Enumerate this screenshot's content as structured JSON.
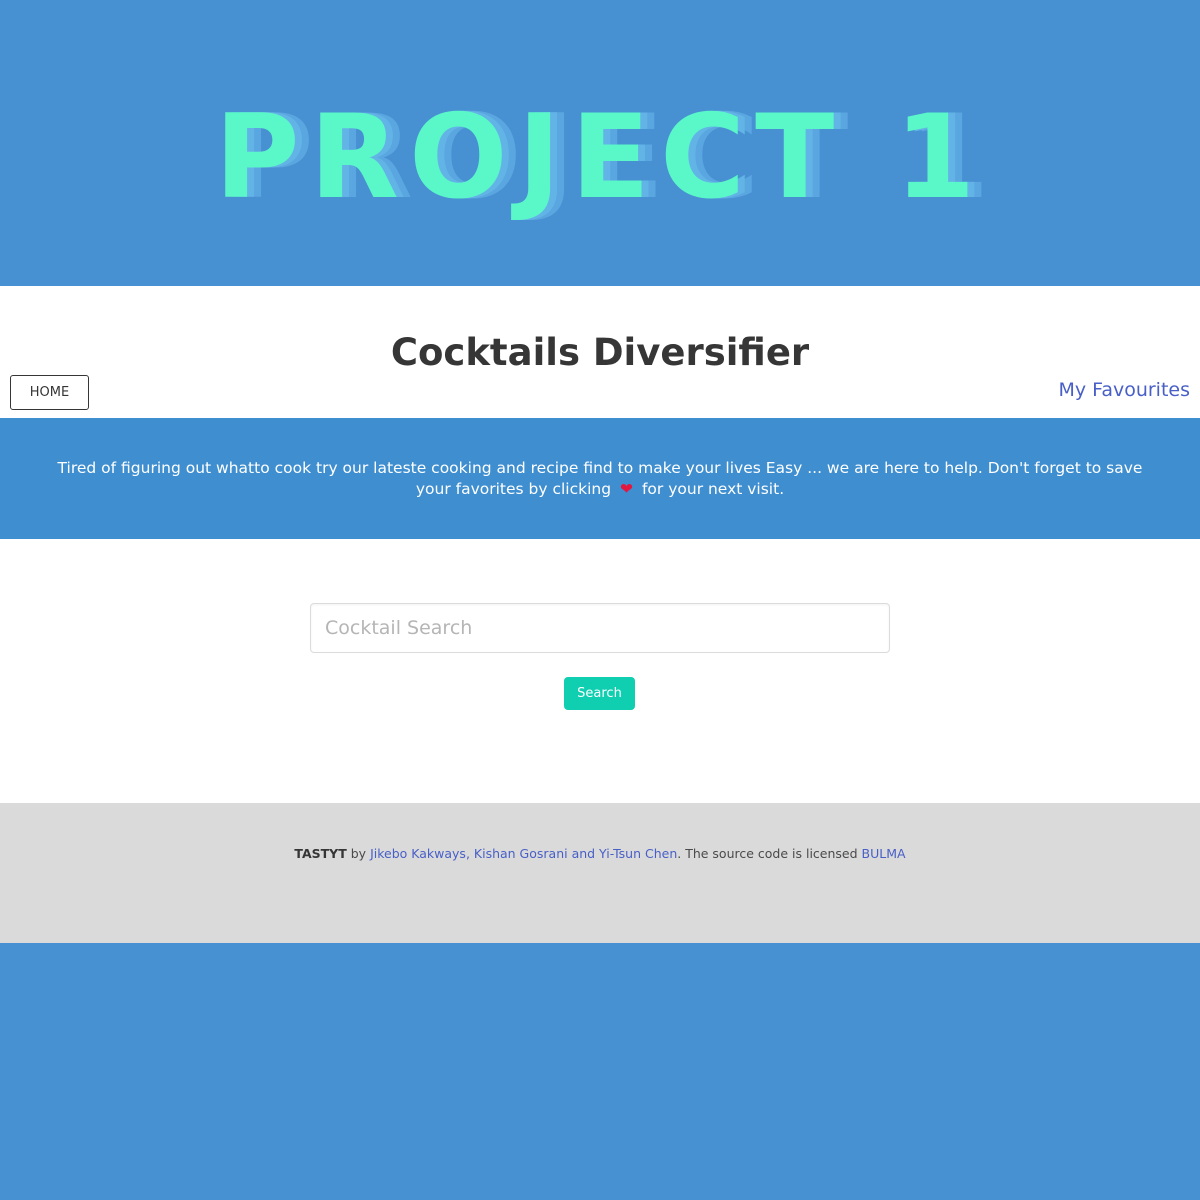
{
  "hero": {
    "title": "PROJECT 1"
  },
  "header": {
    "site_title": "Cocktails Diversifier",
    "home_label": "HOME",
    "favourites_label": "My Favourites"
  },
  "banner": {
    "text_before": "Tired of figuring out whatto cook try our lateste cooking and recipe find to make your lives Easy ... we are here to help. Don't forget to save your favorites by clicking",
    "heart": "❤",
    "text_after": "for your next visit."
  },
  "search": {
    "placeholder": "Cocktail Search",
    "value": "",
    "button_label": "Search"
  },
  "footer": {
    "brand": "TASTYT",
    "by": "by",
    "authors": "Jikebo Kakways, Kishan Gosrani and Yi-Tsun Chen",
    "license_text": ". The source code is licensed",
    "license_link": "BULMA"
  },
  "colors": {
    "page_blue": "#4790d2",
    "banner_blue": "#3e8ed0",
    "hero_text": "#5af7c8",
    "link": "#485fc7",
    "search_button": "#0fcfb0",
    "footer_bg": "#dadada"
  }
}
